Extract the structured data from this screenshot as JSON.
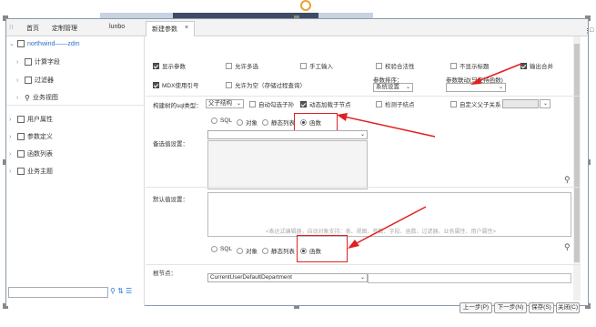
{
  "tabbar": {
    "tabs": [
      "首页",
      "定制管理",
      "lunbo"
    ],
    "active_tab": "新建参数",
    "close": "×"
  },
  "tree": {
    "root": "northwind——zdm",
    "items": [
      "计算字段",
      "过滤器",
      "业务视图"
    ],
    "sections": [
      "用户属性",
      "参数定义",
      "函数列表",
      "业务主题"
    ]
  },
  "options": {
    "show_param": "显示参数",
    "allow_multi": "允许多选",
    "manual_input": "手工输入",
    "validate": "校验合法性",
    "hide_title": "不显示标题",
    "output_merge": "输出合并",
    "mdx_quote": "MDX使用引号",
    "allow_empty": "允许为空（存储过程查询）",
    "sort_label": "参数排序：",
    "sort_value": "系统设置",
    "link_label": "参数联动(只支持函数)",
    "sql_type_label": "构建树的sql类型：",
    "sql_type_value": "父子结构",
    "auto_select": "自动勾选子孙",
    "dynamic_add": "动态加载子节点",
    "check_child": "检测子结点",
    "custom_parent": "自定义父子关系"
  },
  "radios": [
    "SQL",
    "对象",
    "静态列表",
    "函数"
  ],
  "candidate_label": "备选值设置：",
  "default_label": "默认值设置：",
  "default_hint": "<表达式编辑器，自动对象支持：表、视图、参数、字段、函数、过滤器、业务属性、用户属性>",
  "root_label": "根节点：",
  "root_value": "CurrentUserDefaultDepartment",
  "buttons": {
    "prev": "上一步(P)",
    "next": "下一步(N)",
    "save": "保存(S)",
    "close": "关闭(C)"
  }
}
